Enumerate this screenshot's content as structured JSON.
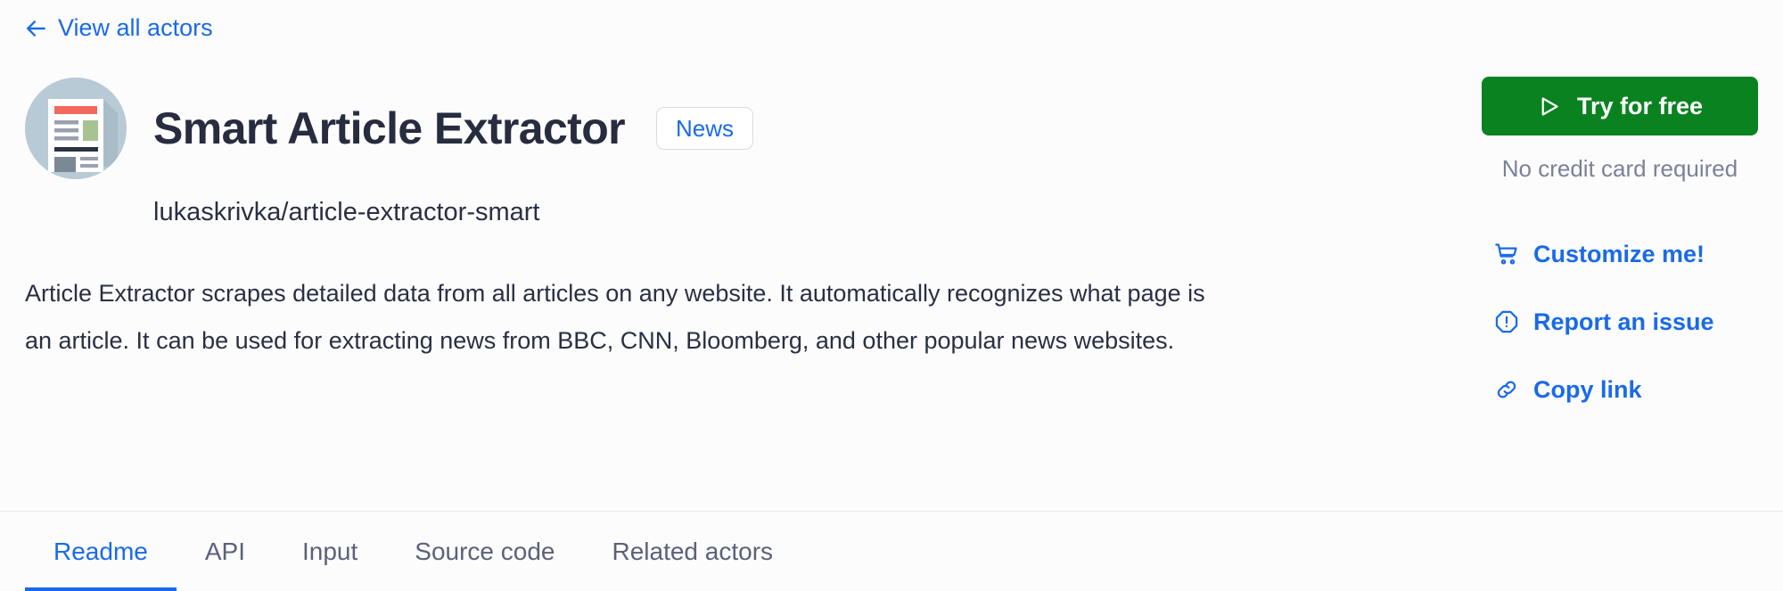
{
  "back_link": {
    "label": "View all actors",
    "icon": "arrow-left-icon"
  },
  "header": {
    "title": "Smart Article Extractor",
    "badge": "News",
    "slug": "lukaskrivka/article-extractor-smart",
    "avatar_icon": "newspaper-article-icon",
    "description": "Article Extractor scrapes detailed data from all articles on any website. It automatically recognizes what page is an article. It can be used for extracting news from BBC, CNN, Bloomberg, and other popular news websites."
  },
  "sidebar": {
    "try_button": {
      "label": "Try for free",
      "icon": "play-icon"
    },
    "no_credit_note": "No credit card required",
    "links": [
      {
        "label": "Customize me!",
        "icon": "shopping-cart-icon"
      },
      {
        "label": "Report an issue",
        "icon": "alert-octagon-icon"
      },
      {
        "label": "Copy link",
        "icon": "link-chain-icon"
      }
    ]
  },
  "tabs": [
    {
      "label": "Readme",
      "active": true
    },
    {
      "label": "API",
      "active": false
    },
    {
      "label": "Input",
      "active": false
    },
    {
      "label": "Source code",
      "active": false
    },
    {
      "label": "Related actors",
      "active": false
    }
  ],
  "colors": {
    "accent_blue": "#1a6ae8",
    "green": "#0a8220",
    "title_dark": "#272c3f",
    "muted": "#7b819a",
    "page_bg": "#fcfcfd"
  }
}
